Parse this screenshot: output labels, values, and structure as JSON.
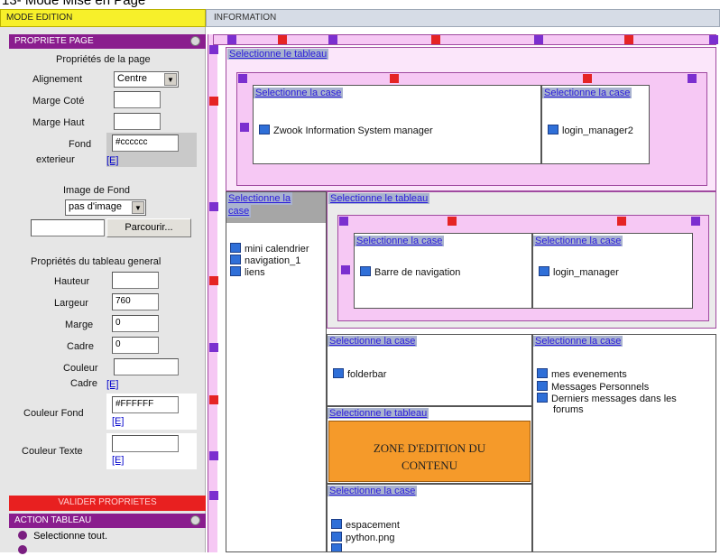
{
  "doc_title": "13- Mode Mise en Page",
  "header": {
    "mode": "MODE EDITION",
    "info": "INFORMATION"
  },
  "page_props": {
    "panel_title": "PROPRIETE PAGE",
    "section_title": "Propriétés de la page",
    "align_label": "Alignement",
    "align_value": "Centre",
    "side_margin_label": "Marge Coté",
    "top_margin_label": "Marge Haut",
    "bg_label_1": "Fond",
    "bg_label_2": "exterieur",
    "bg_value": "#cccccc",
    "e_link": "[E]",
    "bg_image_label": "Image de Fond",
    "bg_image_value": "pas d'image",
    "browse_label": "Parcourir...",
    "table_section_title": "Propriétés du tableau general",
    "height_label": "Hauteur",
    "width_label": "Largeur",
    "width_value": "760",
    "margin_label": "Marge",
    "margin_value": "0",
    "frame_label": "Cadre",
    "frame_value": "0",
    "frame_color_label_1": "Couleur",
    "frame_color_label_2": "Cadre",
    "bg_color_label": "Couleur Fond",
    "bg_color_value": "#FFFFFF",
    "text_color_label": "Couleur Texte",
    "validate_label": "VALIDER PROPRIETES"
  },
  "table_actions": {
    "panel_title": "ACTION TABLEAU",
    "items": [
      "Selectionne tout."
    ]
  },
  "workspace": {
    "select_table": "Selectionne le tableau",
    "select_cell": "Selectionne la case",
    "select_cell_wrap_1": "Selectionne la",
    "select_cell_wrap_2": "case",
    "components": {
      "zwook": "Zwook Information System manager",
      "login2": "login_manager2",
      "calendar": "mini calendrier",
      "nav1": "navigation_1",
      "links": "liens",
      "navbar": "Barre de navigation",
      "login": "login_manager",
      "folderbar": "folderbar",
      "events": "mes evenements",
      "messages": "Messages Personnels",
      "forums_1": "Derniers messages dans les",
      "forums_2": "forums",
      "spacing": "espacement",
      "python": "python.png"
    },
    "edit_zone_1": "ZONE D'EDITION DU",
    "edit_zone_2": "CONTENU"
  },
  "colors": {
    "mode_bar": "#f7f02a",
    "panel_header": "#8a1d8e",
    "validate": "#e82020",
    "edit_zone": "#f59a2a",
    "marker_purple": "#7b2fcf",
    "marker_red": "#e52424"
  }
}
